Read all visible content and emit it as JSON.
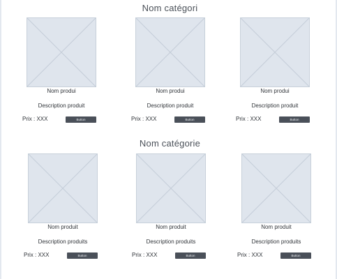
{
  "sections": [
    {
      "title": "Nom catégori",
      "products": [
        {
          "name": "Nom produi",
          "description": "Description produit",
          "price": "Prix : XXX",
          "button": "Button"
        },
        {
          "name": "Nom produi",
          "description": "Description produit",
          "price": "Prix : XXX",
          "button": "Button"
        },
        {
          "name": "Nom produi",
          "description": "Description produit",
          "price": "Prix : XXX",
          "button": "Button"
        }
      ]
    },
    {
      "title": "Nom catégorie",
      "products": [
        {
          "name": "Nom produit",
          "description": "Description produits",
          "price": "Prix : XXX",
          "button": "Button"
        },
        {
          "name": "Nom produit",
          "description": "Description produits",
          "price": "Prix : XXX",
          "button": "Button"
        },
        {
          "name": "Nom produit",
          "description": "Description produits",
          "price": "Prix : XXX",
          "button": "Button"
        }
      ]
    }
  ],
  "icons": {
    "thumbnail": "image-placeholder-icon"
  }
}
